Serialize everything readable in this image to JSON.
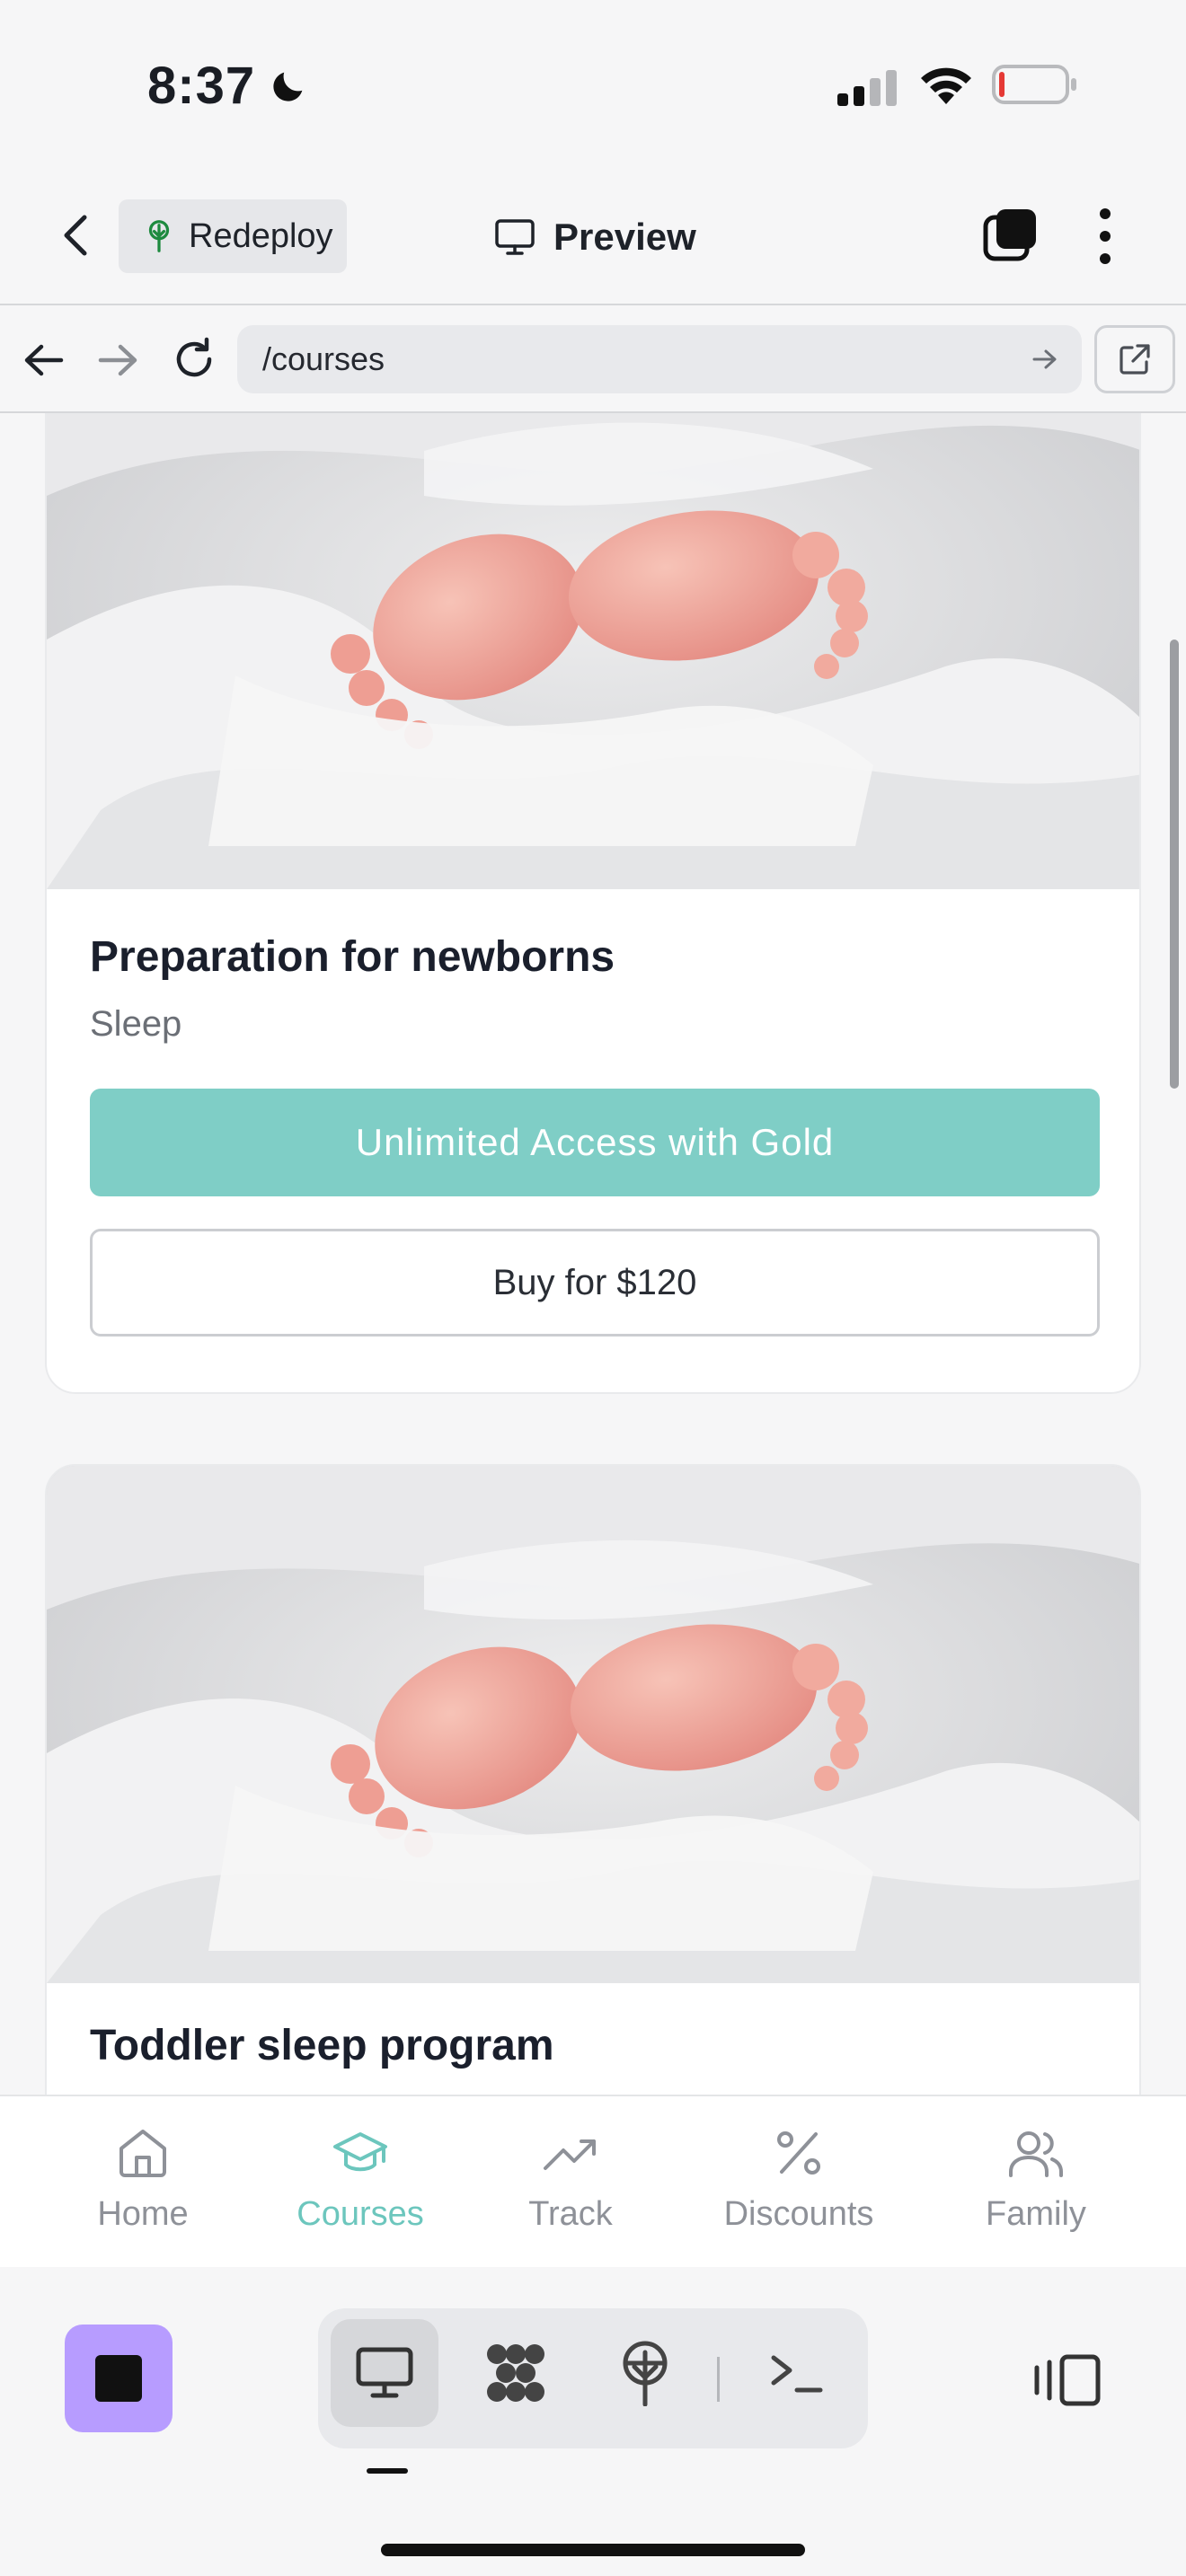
{
  "status_bar": {
    "time": "8:37"
  },
  "app_bar": {
    "redeploy_label": "Redeploy",
    "preview_label": "Preview"
  },
  "url_bar": {
    "path": "/courses"
  },
  "courses": [
    {
      "title": "Preparation for newborns",
      "category": "Sleep",
      "gold_label": "Unlimited Access with Gold",
      "buy_label": "Buy for $120"
    },
    {
      "title": "Toddler sleep program"
    }
  ],
  "tab_bar": {
    "items": [
      {
        "label": "Home",
        "icon": "home-icon",
        "active": false
      },
      {
        "label": "Courses",
        "icon": "graduation-cap-icon",
        "active": true
      },
      {
        "label": "Track",
        "icon": "trend-up-icon",
        "active": false
      },
      {
        "label": "Discounts",
        "icon": "percent-icon",
        "active": false
      },
      {
        "label": "Family",
        "icon": "users-icon",
        "active": false
      }
    ]
  },
  "toolbar": {
    "items": [
      "desktop-icon",
      "workflow-icon",
      "deploy-icon",
      "terminal-icon"
    ],
    "active": "desktop-icon"
  },
  "colors": {
    "accent": "#7fcec6",
    "active_tab": "#6cc6bd",
    "stop_button": "#b79cff"
  }
}
